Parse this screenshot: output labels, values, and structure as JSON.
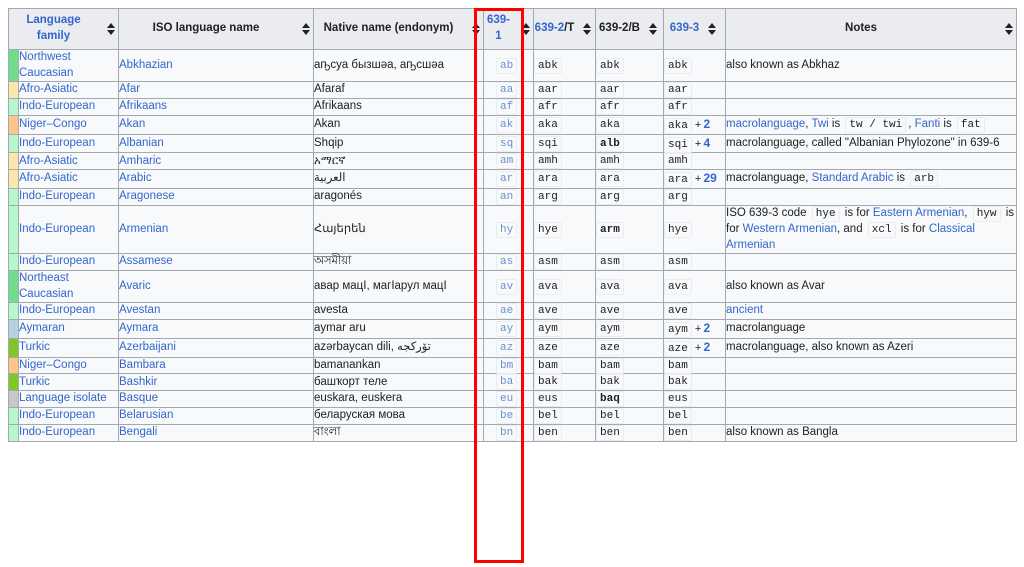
{
  "table": {
    "headers": [
      {
        "id": "language-family",
        "label": "Language family",
        "link": true,
        "sortable": true
      },
      {
        "id": "iso-language-name",
        "label": "ISO language name",
        "link": false,
        "sortable": true
      },
      {
        "id": "native-name",
        "label": "Native name (endonym)",
        "link": false,
        "sortable": true
      },
      {
        "id": "639-1",
        "label": "639-1",
        "link": true,
        "sortable": true
      },
      {
        "id": "639-2-t",
        "label": "639-2",
        "suffix": "/T",
        "link": true,
        "sortable": true
      },
      {
        "id": "639-2-b",
        "label": "639-2/B",
        "link": false,
        "sortable": true
      },
      {
        "id": "639-3",
        "label": "639-3",
        "link": true,
        "sortable": true
      },
      {
        "id": "notes",
        "label": "Notes",
        "link": false,
        "sortable": true
      }
    ],
    "rows": [
      {
        "swatch": "#6fdd8b",
        "family": "Northwest Caucasian",
        "name": "Abkhazian",
        "native": "аҧсуа бызшәа, аҧсшәа",
        "c1": "ab",
        "c2t": "abk",
        "c2b": "abk",
        "c3": "abk",
        "c2b_bold": false,
        "c3_plus": "",
        "notes": [
          {
            "t": "also known as Abkhaz",
            "k": "text"
          }
        ]
      },
      {
        "swatch": "#ffe4ae",
        "family": "Afro-Asiatic",
        "name": "Afar",
        "native": "Afaraf",
        "c1": "aa",
        "c2t": "aar",
        "c2b": "aar",
        "c3": "aar",
        "c2b_bold": false,
        "c3_plus": "",
        "notes": []
      },
      {
        "swatch": "#b6f7cd",
        "family": "Indo-European",
        "name": "Afrikaans",
        "native": "Afrikaans",
        "c1": "af",
        "c2t": "afr",
        "c2b": "afr",
        "c3": "afr",
        "c2b_bold": false,
        "c3_plus": "",
        "notes": []
      },
      {
        "swatch": "#ffc487",
        "family": "Niger–Congo",
        "name": "Akan",
        "native": "Akan",
        "c1": "ak",
        "c2t": "aka",
        "c2b": "aka",
        "c3": "aka",
        "c2b_bold": false,
        "c3_plus": "2",
        "notes": [
          {
            "t": "macrolanguage",
            "k": "link"
          },
          {
            "t": ", ",
            "k": "text"
          },
          {
            "t": "Twi",
            "k": "link"
          },
          {
            "t": " is ",
            "k": "text"
          },
          {
            "t": "tw / twi",
            "k": "code"
          },
          {
            "t": ", ",
            "k": "text"
          },
          {
            "t": "Fanti",
            "k": "link"
          },
          {
            "t": " is ",
            "k": "text"
          },
          {
            "t": "fat",
            "k": "code"
          }
        ]
      },
      {
        "swatch": "#b6f7cd",
        "family": "Indo-European",
        "name": "Albanian",
        "native": "Shqip",
        "c1": "sq",
        "c2t": "sqi",
        "c2b": "alb",
        "c3": "sqi",
        "c2b_bold": true,
        "c3_plus": "4",
        "notes": [
          {
            "t": "macrolanguage, called \"Albanian Phylozone\" in 639-6",
            "k": "text"
          }
        ]
      },
      {
        "swatch": "#ffe4ae",
        "family": "Afro-Asiatic",
        "name": "Amharic",
        "native": "አማርኛ",
        "c1": "am",
        "c2t": "amh",
        "c2b": "amh",
        "c3": "amh",
        "c2b_bold": false,
        "c3_plus": "",
        "notes": []
      },
      {
        "swatch": "#ffe4ae",
        "family": "Afro-Asiatic",
        "name": "Arabic",
        "native": "العربية",
        "c1": "ar",
        "c2t": "ara",
        "c2b": "ara",
        "c3": "ara",
        "c2b_bold": false,
        "c3_plus": "29",
        "notes": [
          {
            "t": "macrolanguage",
            "k": "text"
          },
          {
            "t": ", ",
            "k": "text"
          },
          {
            "t": "Standard Arabic",
            "k": "link"
          },
          {
            "t": " is ",
            "k": "text"
          },
          {
            "t": "arb",
            "k": "code"
          }
        ]
      },
      {
        "swatch": "#b6f7cd",
        "family": "Indo-European",
        "name": "Aragonese",
        "native": "aragonés",
        "c1": "an",
        "c2t": "arg",
        "c2b": "arg",
        "c3": "arg",
        "c2b_bold": false,
        "c3_plus": "",
        "notes": []
      },
      {
        "swatch": "#b6f7cd",
        "family": "Indo-European",
        "name": "Armenian",
        "native": "Հայերեն",
        "c1": "hy",
        "c2t": "hye",
        "c2b": "arm",
        "c3": "hye",
        "c2b_bold": true,
        "c3_plus": "",
        "notes": [
          {
            "t": "ISO 639-3 code ",
            "k": "text"
          },
          {
            "t": "hye",
            "k": "code"
          },
          {
            "t": " is for ",
            "k": "text"
          },
          {
            "t": "Eastern Armenian",
            "k": "link"
          },
          {
            "t": ", ",
            "k": "text"
          },
          {
            "t": "hyw",
            "k": "code"
          },
          {
            "t": " is for ",
            "k": "text"
          },
          {
            "t": "Western Armenian",
            "k": "link"
          },
          {
            "t": ", and ",
            "k": "text"
          },
          {
            "t": "xcl",
            "k": "code"
          },
          {
            "t": " is for ",
            "k": "text"
          },
          {
            "t": "Classical Armenian",
            "k": "link"
          }
        ]
      },
      {
        "swatch": "#b6f7cd",
        "family": "Indo-European",
        "name": "Assamese",
        "native": "অসমীয়া",
        "c1": "as",
        "c2t": "asm",
        "c2b": "asm",
        "c3": "asm",
        "c2b_bold": false,
        "c3_plus": "",
        "notes": []
      },
      {
        "swatch": "#6fdd8b",
        "family": "Northeast Caucasian",
        "name": "Avaric",
        "native": "авар мацӀ, магӀарул мацӀ",
        "c1": "av",
        "c2t": "ava",
        "c2b": "ava",
        "c3": "ava",
        "c2b_bold": false,
        "c3_plus": "",
        "notes": [
          {
            "t": "also known as Avar",
            "k": "text"
          }
        ]
      },
      {
        "swatch": "#b6f7cd",
        "family": "Indo-European",
        "name": "Avestan",
        "native": "avesta",
        "c1": "ae",
        "c2t": "ave",
        "c2b": "ave",
        "c3": "ave",
        "c2b_bold": false,
        "c3_plus": "",
        "notes": [
          {
            "t": "ancient",
            "k": "link"
          }
        ]
      },
      {
        "swatch": "#b5d2e0",
        "family": "Aymaran",
        "name": "Aymara",
        "native": "aymar aru",
        "c1": "ay",
        "c2t": "aym",
        "c2b": "aym",
        "c3": "aym",
        "c2b_bold": false,
        "c3_plus": "2",
        "notes": [
          {
            "t": "macrolanguage",
            "k": "text"
          }
        ]
      },
      {
        "swatch": "#7fc726",
        "family": "Turkic",
        "name": "Azerbaijani",
        "native": "azərbaycan dili, تۆرکجه",
        "c1": "az",
        "c2t": "aze",
        "c2b": "aze",
        "c3": "aze",
        "c2b_bold": false,
        "c3_plus": "2",
        "notes": [
          {
            "t": "macrolanguage, also known as Azeri",
            "k": "text"
          }
        ]
      },
      {
        "swatch": "#ffc487",
        "family": "Niger–Congo",
        "name": "Bambara",
        "native": "bamanankan",
        "c1": "bm",
        "c2t": "bam",
        "c2b": "bam",
        "c3": "bam",
        "c2b_bold": false,
        "c3_plus": "",
        "notes": []
      },
      {
        "swatch": "#7fc726",
        "family": "Turkic",
        "name": "Bashkir",
        "native": "башҡорт теле",
        "c1": "ba",
        "c2t": "bak",
        "c2b": "bak",
        "c3": "bak",
        "c2b_bold": false,
        "c3_plus": "",
        "notes": []
      },
      {
        "swatch": "#c8c8c8",
        "family": "Language isolate",
        "name": "Basque",
        "native": "euskara, euskera",
        "c1": "eu",
        "c2t": "eus",
        "c2b": "baq",
        "c3": "eus",
        "c2b_bold": true,
        "c3_plus": "",
        "notes": []
      },
      {
        "swatch": "#b6f7cd",
        "family": "Indo-European",
        "name": "Belarusian",
        "native": "беларуская мова",
        "c1": "be",
        "c2t": "bel",
        "c2b": "bel",
        "c3": "bel",
        "c2b_bold": false,
        "c3_plus": "",
        "notes": []
      },
      {
        "swatch": "#b6f7cd",
        "family": "Indo-European",
        "name": "Bengali",
        "native": "বাংলা",
        "c1": "bn",
        "c2t": "ben",
        "c2b": "ben",
        "c3": "ben",
        "c2b_bold": false,
        "c3_plus": "",
        "notes": [
          {
            "t": "also known as Bangla",
            "k": "text"
          }
        ]
      }
    ],
    "annotation": {
      "highlight_color": "#ff0000",
      "highlight_target": "639-1"
    }
  }
}
